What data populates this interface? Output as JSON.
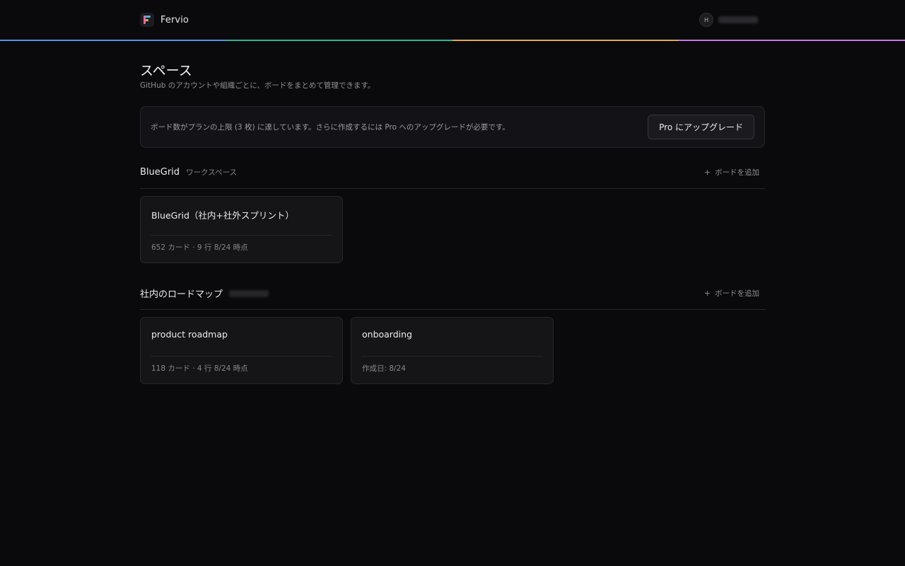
{
  "header": {
    "app_name": "Fervio",
    "logo_icon": "fervio-logo-icon",
    "avatar_initial": "H",
    "rainbow_colors": [
      "#5a8fe6",
      "#2fb39a",
      "#e0a94a",
      "#c77be0"
    ]
  },
  "page": {
    "title": "スペース",
    "subtitle": "GitHub のアカウントや組織ごとに、ボードをまとめて管理できます。"
  },
  "limit_banner": {
    "message": "ボード数がプランの上限 (3 枚) に達しています。さらに作成するには Pro へのアップグレードが必要です。",
    "button_label": "Pro にアップグレード"
  },
  "sections": [
    {
      "title": "BlueGrid",
      "tag": "ワークスペース",
      "add_label": "ボードを追加",
      "boards": [
        {
          "title": "BlueGrid（社内+社外スプリント）",
          "meta": "652 カード · 9 行  8/24 時点"
        }
      ]
    },
    {
      "title": "社内のロードマップ",
      "tag": "",
      "add_label": "ボードを追加",
      "boards": [
        {
          "title": "product roadmap",
          "meta": "118 カード · 4 行  8/24 時点"
        },
        {
          "title": "onboarding",
          "meta": "作成日: 8/24"
        }
      ]
    }
  ]
}
